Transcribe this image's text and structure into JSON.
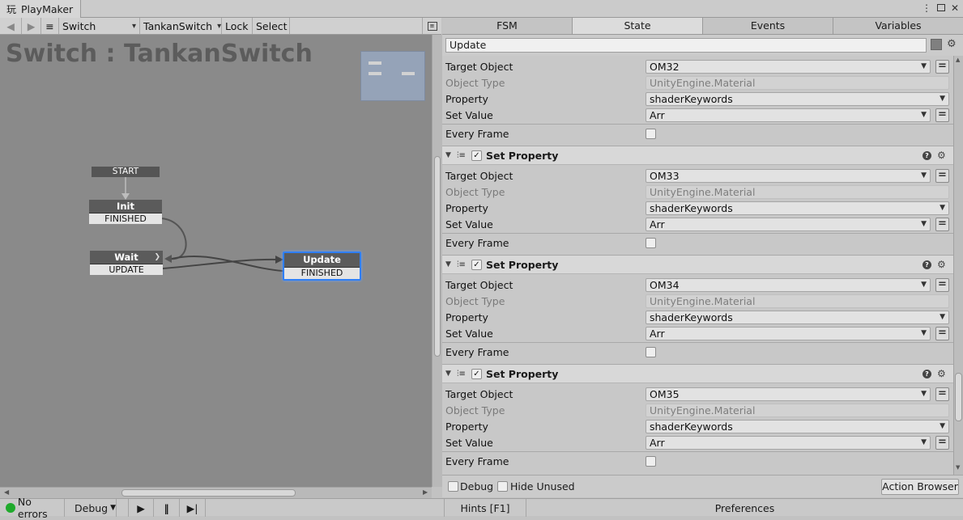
{
  "window": {
    "tab_title": "PlayMaker"
  },
  "toolbar": {
    "fsm_select": "Switch",
    "object_select": "TankanSwitch",
    "lock_label": "Lock",
    "select_label": "Select"
  },
  "graph": {
    "title": "Switch : TankanSwitch",
    "start_label": "START",
    "states": [
      {
        "name": "Init",
        "event": "FINISHED"
      },
      {
        "name": "Wait",
        "event": "UPDATE"
      },
      {
        "name": "Update",
        "event": "FINISHED"
      }
    ]
  },
  "tabs": [
    "FSM",
    "State",
    "Events",
    "Variables"
  ],
  "state_name": "Update",
  "actions": [
    {
      "target_object": "OM32",
      "object_type": "UnityEngine.Material",
      "property": "shaderKeywords",
      "set_value": "Arr"
    },
    {
      "title": "Set Property",
      "target_object": "OM33",
      "object_type": "UnityEngine.Material",
      "property": "shaderKeywords",
      "set_value": "Arr"
    },
    {
      "title": "Set Property",
      "target_object": "OM34",
      "object_type": "UnityEngine.Material",
      "property": "shaderKeywords",
      "set_value": "Arr"
    },
    {
      "title": "Set Property",
      "target_object": "OM35",
      "object_type": "UnityEngine.Material",
      "property": "shaderKeywords",
      "set_value": "Arr"
    }
  ],
  "labels": {
    "target_object": "Target Object",
    "object_type": "Object Type",
    "property": "Property",
    "set_value": "Set Value",
    "every_frame": "Every Frame"
  },
  "bottom": {
    "debug_label": "Debug",
    "hide_unused_label": "Hide Unused",
    "action_browser_label": "Action Browser"
  },
  "status": {
    "errors": "No errors",
    "debug_mode": "Debug",
    "hints": "Hints [F1]",
    "preferences": "Preferences"
  }
}
